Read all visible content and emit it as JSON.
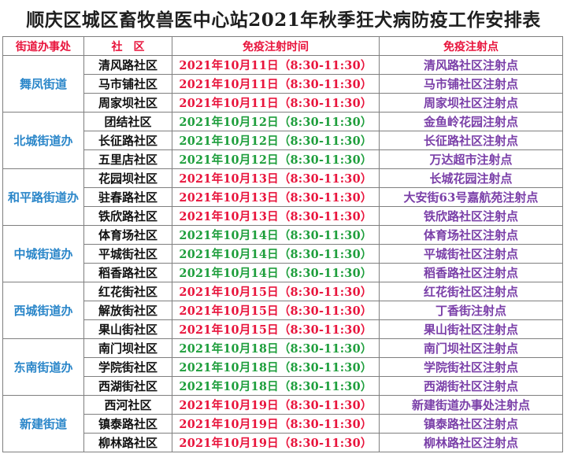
{
  "title": "顺庆区城区畜牧兽医中心站2021年秋季狂犬病防疫工作安排表",
  "headers": [
    "街道办事处",
    "社　区",
    "免疫注射时间",
    "免疫注射点"
  ],
  "groups": [
    {
      "office": "舞凤街道",
      "time_color": "red",
      "rows": [
        {
          "community": "清风路社区",
          "time": "2021年10月11日（8:30-11:30）",
          "site": "清风路社区注射点"
        },
        {
          "community": "马市铺社区",
          "time": "2021年10月11日（8:30-11:30）",
          "site": "马市铺社区注射点"
        },
        {
          "community": "周家坝社区",
          "time": "2021年10月11日（8:30-11:30）",
          "site": "周家坝社区注射点"
        }
      ]
    },
    {
      "office": "北城街道办",
      "time_color": "green",
      "rows": [
        {
          "community": "团结社区",
          "time": "2021年10月12日（8:30-11:30）",
          "site": "金鱼岭花园注射点"
        },
        {
          "community": "长征路社区",
          "time": "2021年10月12日（8:30-11:30）",
          "site": "长征路社区注射点"
        },
        {
          "community": "五里店社区",
          "time": "2021年10月12日（8:30-11:30）",
          "site": "万达超市注射点"
        }
      ]
    },
    {
      "office": "和平路街道办",
      "time_color": "red",
      "rows": [
        {
          "community": "花园坝社区",
          "time": "2021年10月13日（8:30-11:30）",
          "site": "长城花园注射点"
        },
        {
          "community": "驻春路社区",
          "time": "2021年10月13日（8:30-11:30）",
          "site": "大安街63号嘉航苑注射点"
        },
        {
          "community": "铁欣路社区",
          "time": "2021年10月13日（8:30-11:30）",
          "site": "铁欣路社区注射点"
        }
      ]
    },
    {
      "office": "中城街道办",
      "time_color": "green",
      "rows": [
        {
          "community": "体育场社区",
          "time": "2021年10月14日（8:30-11:30）",
          "site": "体育场社区注射点"
        },
        {
          "community": "平城街社区",
          "time": "2021年10月14日（8:30-11:30）",
          "site": "平城街社区注射点"
        },
        {
          "community": "稻香路社区",
          "time": "2021年10月14日（8:30-11:30）",
          "site": "稻香路社区注射点"
        }
      ]
    },
    {
      "office": "西城街道办",
      "time_color": "red",
      "rows": [
        {
          "community": "红花街社区",
          "time": "2021年10月15日（8:30-11:30）",
          "site": "红花街社区注射点"
        },
        {
          "community": "解放街社区",
          "time": "2021年10月15日（8:30-11:30）",
          "site": "丁香街注射点"
        },
        {
          "community": "果山街社区",
          "time": "2021年10月15日（8:30-11:30）",
          "site": "果山街社区注射点"
        }
      ]
    },
    {
      "office": "东南街道办",
      "time_color": "green",
      "rows": [
        {
          "community": "南门坝社区",
          "time": "2021年10月18日（8:30-11:30）",
          "site": "南门坝社区注射点"
        },
        {
          "community": "学院街社区",
          "time": "2021年10月18日（8:30-11:30）",
          "site": "学院街社区注射点"
        },
        {
          "community": "西湖街社区",
          "time": "2021年10月18日（8:30-11:30）",
          "site": "西湖街社区注射点"
        }
      ]
    },
    {
      "office": "新建街道",
      "time_color": "red",
      "rows": [
        {
          "community": "西河社区",
          "time": "2021年10月19日（8:30-11:30）",
          "site": "新建街道办事处注射点"
        },
        {
          "community": "镇泰路社区",
          "time": "2021年10月19日（8:30-11:30）",
          "site": "镇泰路社区注射点"
        },
        {
          "community": "柳林路社区",
          "time": "2021年10月19日（8:30-11:30）",
          "site": "柳林路社区注射点"
        }
      ]
    }
  ],
  "colors": {
    "header_text": "#e8143c",
    "office_text": "#2a86c9",
    "time_red": "#e8143c",
    "time_green": "#1e9e3c",
    "site_text": "#7a3fa8"
  }
}
